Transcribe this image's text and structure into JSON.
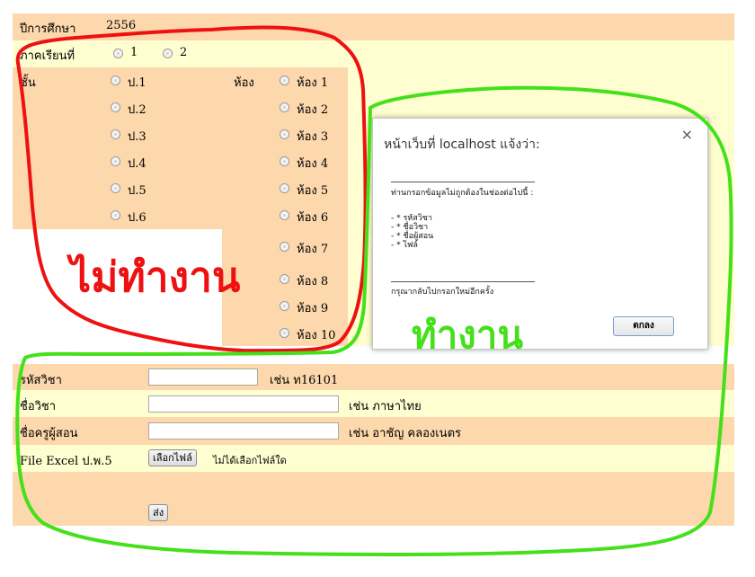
{
  "form": {
    "year_label": "ปีการศึกษา",
    "year_value": "2556",
    "semester_label": "ภาคเรียนที่",
    "semester_options": [
      "1",
      "2"
    ],
    "grade_label": "ชั้น",
    "grade_options": [
      "ป.1",
      "ป.2",
      "ป.3",
      "ป.4",
      "ป.5",
      "ป.6"
    ],
    "room_label": "ห้อง",
    "room_options": [
      "ห้อง 1",
      "ห้อง 2",
      "ห้อง 3",
      "ห้อง 4",
      "ห้อง 5",
      "ห้อง 6",
      "ห้อง 7",
      "ห้อง 8",
      "ห้อง 9",
      "ห้อง 10"
    ],
    "subject_code_label": "รหัสวิชา",
    "subject_code_hint": "เช่น ท16101",
    "subject_name_label": "ชื่อวิชา",
    "subject_name_hint": "เช่น ภาษาไทย",
    "teacher_label": "ชื่อครูผู้สอน",
    "teacher_hint": "เช่น อาชัญ คลองเนตร",
    "file_label": "File Excel ป.พ.5",
    "file_button": "เลือกไฟล์",
    "file_status": "ไม่ได้เลือกไฟล์ใด",
    "submit_label": "ส่ง"
  },
  "dialog": {
    "title": "หน้าเว็บที่ localhost แจ้งว่า:",
    "close": "×",
    "message": "ท่านกรอกข้อมูลไม่ถูกต้องในช่องต่อไปนี้ :",
    "items": [
      "- * รหัสวิชา",
      "- * ชื่อวิชา",
      "- * ชื่อผู้สอน",
      "- * ไฟล์"
    ],
    "footer": "กรุณากลับไปกรอกใหม่อีกครั้ง",
    "ok_label": "ตกลง"
  },
  "annotations": {
    "not_working": "ไม่ทำงาน",
    "working": "ทำงาน",
    "red": "#ee1111",
    "green": "#44e01a"
  }
}
